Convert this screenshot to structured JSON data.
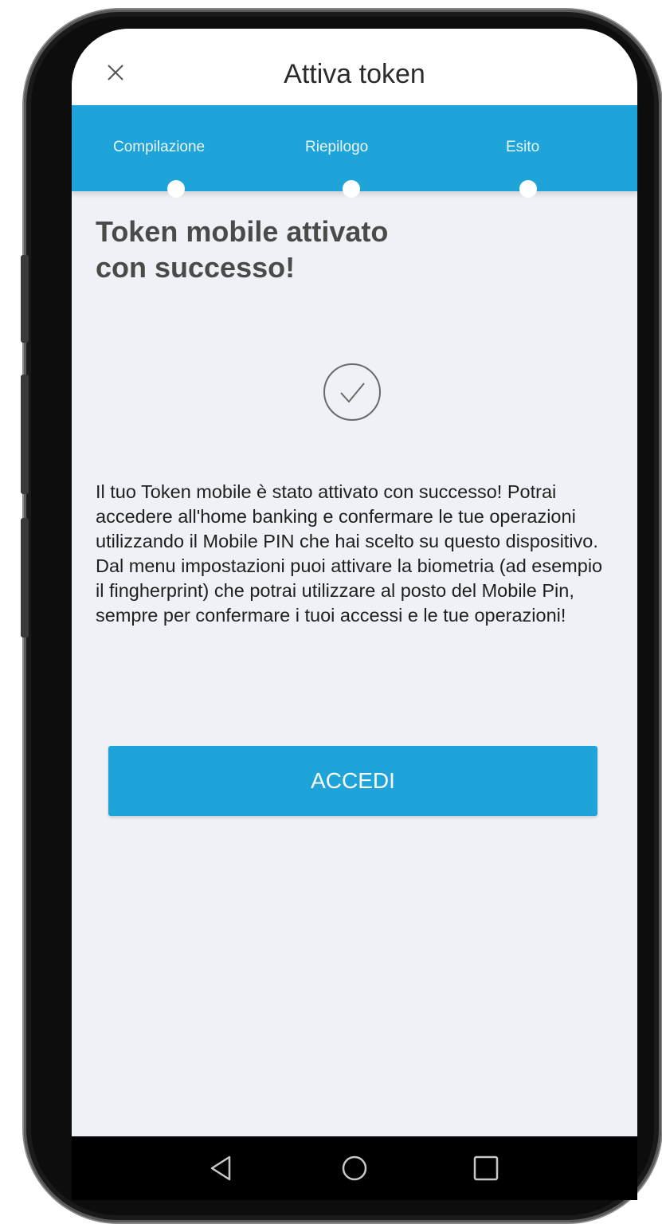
{
  "header": {
    "title": "Attiva token",
    "close_icon": "close-icon"
  },
  "steps": [
    {
      "label": "Compilazione"
    },
    {
      "label": "Riepilogo"
    },
    {
      "label": "Esito"
    }
  ],
  "result": {
    "title": "Token mobile attivato con successo!",
    "icon": "check-circle-icon",
    "message": "Il tuo Token mobile è stato attivato con successo! Potrai accedere all'home banking e confermare le tue operazioni utilizzando il Mobile PIN che hai scelto su questo dispositivo. Dal menu impostazioni puoi attivare la biometria (ad esempio il fingherprint) che potrai utilizzare al posto del Mobile Pin, sempre per confermare i tuoi accessi e le tue operazioni!"
  },
  "actions": {
    "accedi_label": "ACCEDI"
  },
  "navbar": {
    "icons": [
      "back-icon",
      "home-icon",
      "recents-icon"
    ]
  },
  "colors": {
    "accent": "#1ea4d9",
    "background": "#eef1f5"
  }
}
